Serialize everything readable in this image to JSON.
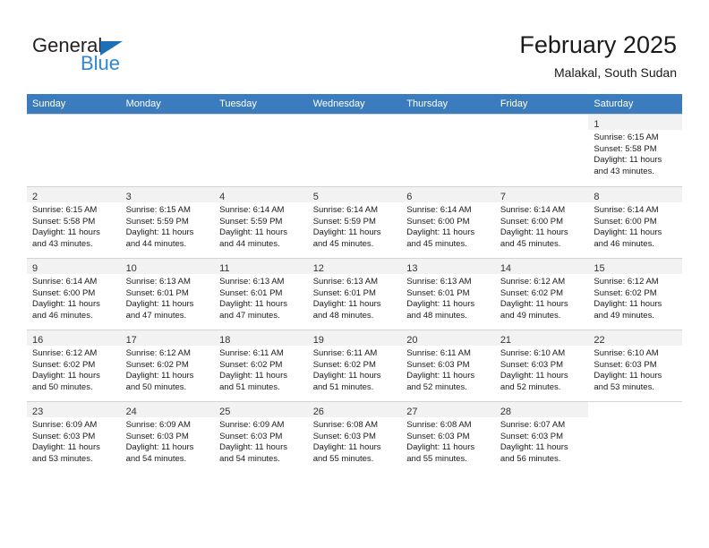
{
  "brand": {
    "name_part1": "General",
    "name_part2": "Blue",
    "triangle_color": "#1d70b8",
    "blue_color": "#2f87d4"
  },
  "header": {
    "month_title": "February 2025",
    "location": "Malakal, South Sudan"
  },
  "theme": {
    "header_row_bg": "#3a7cbe",
    "daynum_bg": "#f2f2f2",
    "grid_line": "#d4d4d4",
    "text": "#1a1a1a"
  },
  "weekdays": [
    "Sunday",
    "Monday",
    "Tuesday",
    "Wednesday",
    "Thursday",
    "Friday",
    "Saturday"
  ],
  "labels": {
    "sunrise_prefix": "Sunrise:",
    "sunset_prefix": "Sunset:",
    "daylight_prefix": "Daylight:"
  },
  "weeks": [
    [
      {
        "day": "",
        "empty": true
      },
      {
        "day": "",
        "empty": true
      },
      {
        "day": "",
        "empty": true
      },
      {
        "day": "",
        "empty": true
      },
      {
        "day": "",
        "empty": true
      },
      {
        "day": "",
        "empty": true
      },
      {
        "day": "1",
        "sunrise": "Sunrise: 6:15 AM",
        "sunset": "Sunset: 5:58 PM",
        "daylight1": "Daylight: 11 hours",
        "daylight2": "and 43 minutes."
      }
    ],
    [
      {
        "day": "2",
        "sunrise": "Sunrise: 6:15 AM",
        "sunset": "Sunset: 5:58 PM",
        "daylight1": "Daylight: 11 hours",
        "daylight2": "and 43 minutes."
      },
      {
        "day": "3",
        "sunrise": "Sunrise: 6:15 AM",
        "sunset": "Sunset: 5:59 PM",
        "daylight1": "Daylight: 11 hours",
        "daylight2": "and 44 minutes."
      },
      {
        "day": "4",
        "sunrise": "Sunrise: 6:14 AM",
        "sunset": "Sunset: 5:59 PM",
        "daylight1": "Daylight: 11 hours",
        "daylight2": "and 44 minutes."
      },
      {
        "day": "5",
        "sunrise": "Sunrise: 6:14 AM",
        "sunset": "Sunset: 5:59 PM",
        "daylight1": "Daylight: 11 hours",
        "daylight2": "and 45 minutes."
      },
      {
        "day": "6",
        "sunrise": "Sunrise: 6:14 AM",
        "sunset": "Sunset: 6:00 PM",
        "daylight1": "Daylight: 11 hours",
        "daylight2": "and 45 minutes."
      },
      {
        "day": "7",
        "sunrise": "Sunrise: 6:14 AM",
        "sunset": "Sunset: 6:00 PM",
        "daylight1": "Daylight: 11 hours",
        "daylight2": "and 45 minutes."
      },
      {
        "day": "8",
        "sunrise": "Sunrise: 6:14 AM",
        "sunset": "Sunset: 6:00 PM",
        "daylight1": "Daylight: 11 hours",
        "daylight2": "and 46 minutes."
      }
    ],
    [
      {
        "day": "9",
        "sunrise": "Sunrise: 6:14 AM",
        "sunset": "Sunset: 6:00 PM",
        "daylight1": "Daylight: 11 hours",
        "daylight2": "and 46 minutes."
      },
      {
        "day": "10",
        "sunrise": "Sunrise: 6:13 AM",
        "sunset": "Sunset: 6:01 PM",
        "daylight1": "Daylight: 11 hours",
        "daylight2": "and 47 minutes."
      },
      {
        "day": "11",
        "sunrise": "Sunrise: 6:13 AM",
        "sunset": "Sunset: 6:01 PM",
        "daylight1": "Daylight: 11 hours",
        "daylight2": "and 47 minutes."
      },
      {
        "day": "12",
        "sunrise": "Sunrise: 6:13 AM",
        "sunset": "Sunset: 6:01 PM",
        "daylight1": "Daylight: 11 hours",
        "daylight2": "and 48 minutes."
      },
      {
        "day": "13",
        "sunrise": "Sunrise: 6:13 AM",
        "sunset": "Sunset: 6:01 PM",
        "daylight1": "Daylight: 11 hours",
        "daylight2": "and 48 minutes."
      },
      {
        "day": "14",
        "sunrise": "Sunrise: 6:12 AM",
        "sunset": "Sunset: 6:02 PM",
        "daylight1": "Daylight: 11 hours",
        "daylight2": "and 49 minutes."
      },
      {
        "day": "15",
        "sunrise": "Sunrise: 6:12 AM",
        "sunset": "Sunset: 6:02 PM",
        "daylight1": "Daylight: 11 hours",
        "daylight2": "and 49 minutes."
      }
    ],
    [
      {
        "day": "16",
        "sunrise": "Sunrise: 6:12 AM",
        "sunset": "Sunset: 6:02 PM",
        "daylight1": "Daylight: 11 hours",
        "daylight2": "and 50 minutes."
      },
      {
        "day": "17",
        "sunrise": "Sunrise: 6:12 AM",
        "sunset": "Sunset: 6:02 PM",
        "daylight1": "Daylight: 11 hours",
        "daylight2": "and 50 minutes."
      },
      {
        "day": "18",
        "sunrise": "Sunrise: 6:11 AM",
        "sunset": "Sunset: 6:02 PM",
        "daylight1": "Daylight: 11 hours",
        "daylight2": "and 51 minutes."
      },
      {
        "day": "19",
        "sunrise": "Sunrise: 6:11 AM",
        "sunset": "Sunset: 6:02 PM",
        "daylight1": "Daylight: 11 hours",
        "daylight2": "and 51 minutes."
      },
      {
        "day": "20",
        "sunrise": "Sunrise: 6:11 AM",
        "sunset": "Sunset: 6:03 PM",
        "daylight1": "Daylight: 11 hours",
        "daylight2": "and 52 minutes."
      },
      {
        "day": "21",
        "sunrise": "Sunrise: 6:10 AM",
        "sunset": "Sunset: 6:03 PM",
        "daylight1": "Daylight: 11 hours",
        "daylight2": "and 52 minutes."
      },
      {
        "day": "22",
        "sunrise": "Sunrise: 6:10 AM",
        "sunset": "Sunset: 6:03 PM",
        "daylight1": "Daylight: 11 hours",
        "daylight2": "and 53 minutes."
      }
    ],
    [
      {
        "day": "23",
        "sunrise": "Sunrise: 6:09 AM",
        "sunset": "Sunset: 6:03 PM",
        "daylight1": "Daylight: 11 hours",
        "daylight2": "and 53 minutes."
      },
      {
        "day": "24",
        "sunrise": "Sunrise: 6:09 AM",
        "sunset": "Sunset: 6:03 PM",
        "daylight1": "Daylight: 11 hours",
        "daylight2": "and 54 minutes."
      },
      {
        "day": "25",
        "sunrise": "Sunrise: 6:09 AM",
        "sunset": "Sunset: 6:03 PM",
        "daylight1": "Daylight: 11 hours",
        "daylight2": "and 54 minutes."
      },
      {
        "day": "26",
        "sunrise": "Sunrise: 6:08 AM",
        "sunset": "Sunset: 6:03 PM",
        "daylight1": "Daylight: 11 hours",
        "daylight2": "and 55 minutes."
      },
      {
        "day": "27",
        "sunrise": "Sunrise: 6:08 AM",
        "sunset": "Sunset: 6:03 PM",
        "daylight1": "Daylight: 11 hours",
        "daylight2": "and 55 minutes."
      },
      {
        "day": "28",
        "sunrise": "Sunrise: 6:07 AM",
        "sunset": "Sunset: 6:03 PM",
        "daylight1": "Daylight: 11 hours",
        "daylight2": "and 56 minutes."
      },
      {
        "day": "",
        "empty": true
      }
    ]
  ]
}
